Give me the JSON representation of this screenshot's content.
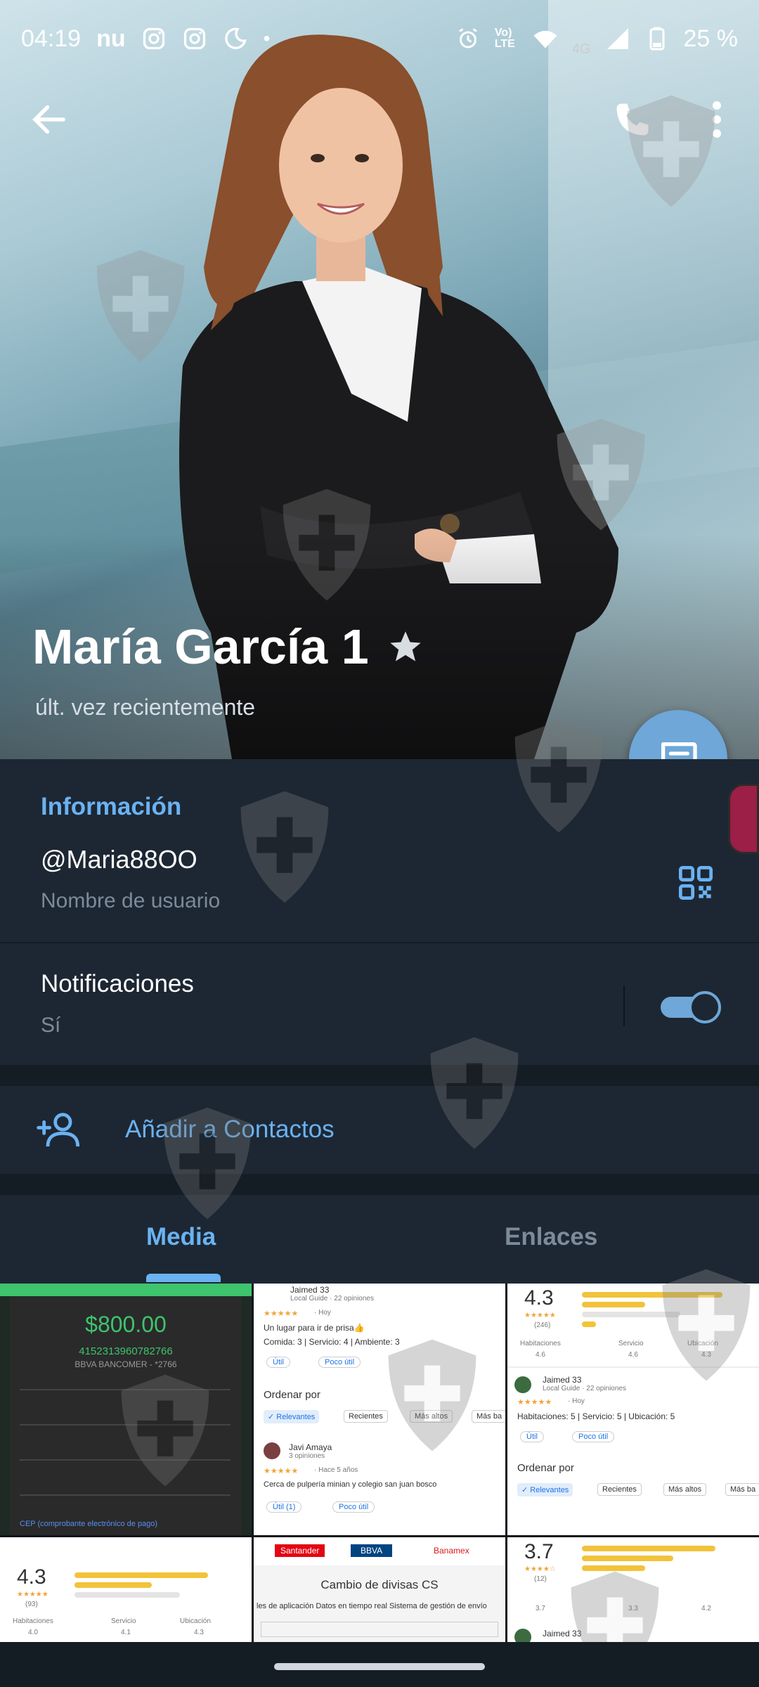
{
  "status_bar": {
    "time": "04:19",
    "carrier_text": "nu",
    "network_volte": "Vo) LTE",
    "network_gen": "4G",
    "battery": "25 %"
  },
  "profile": {
    "name": "María García 1",
    "last_seen": "últ. vez recientemente"
  },
  "info": {
    "section_title": "Información",
    "username": "@Maria88OO",
    "username_caption": "Nombre de usuario",
    "notifications_label": "Notificaciones",
    "notifications_value": "Sí",
    "notifications_on": true
  },
  "actions": {
    "add_contact": "Añadir a Contactos"
  },
  "tabs": [
    {
      "label": "Media",
      "active": true
    },
    {
      "label": "Enlaces",
      "active": false
    }
  ],
  "media": {
    "transfer": {
      "amount": "$800.00",
      "account": "4152313960782766",
      "bank": "BBVA BANCOMER - *2766",
      "link": "CEP (comprobante electrónico de pago)"
    },
    "review1": {
      "author": "Jaimed 33",
      "meta": "Local Guide · 22 opiniones",
      "when": "· Hoy",
      "text": "Un lugar para ir de prisa👍",
      "scores": "Comida: 3 | Servicio: 4 | Ambiente: 3",
      "btn_useful": "Útil",
      "btn_not_useful": "Poco útil",
      "order_by": "Ordenar por",
      "chips": [
        "✓ Relevantes",
        "Recientes",
        "Más altos",
        "Más ba"
      ],
      "author2": "Javi Amaya",
      "meta2": "3 opiniones",
      "when2": "· Hace 5 años",
      "text2": "Cerca de pulpería minian y colegio san juan bosco",
      "btn_useful2": "Útil (1)",
      "btn_not_useful2": "Poco útil"
    },
    "review2": {
      "rating": "4.3",
      "count": "(246)",
      "sub_labels": [
        "Habitaciones",
        "Servicio",
        "Ubicación"
      ],
      "sub_values": [
        "4.6",
        "4.6",
        "4.3"
      ],
      "author": "Jaimed 33",
      "meta": "Local Guide · 22 opiniones",
      "when": "· Hoy",
      "scores": "Habitaciones: 5 | Servicio: 5 | Ubicación: 5",
      "btn_useful": "Útil",
      "btn_not_useful": "Poco útil",
      "order_by": "Ordenar por",
      "chips": [
        "✓ Relevantes",
        "Recientes",
        "Más altos",
        "Más ba"
      ]
    },
    "review3": {
      "rating": "4.3",
      "count": "(93)",
      "sub_labels": [
        "Habitaciones",
        "Servicio",
        "Ubicación"
      ],
      "sub_values": [
        "4.0",
        "4.1",
        "4.3"
      ]
    },
    "exchange": {
      "brand1": "Santander",
      "brand2": "BBVA",
      "brand3": "Banamex",
      "title": "Cambio de divisas CS",
      "text": "les de aplicación Datos en tiempo real Sistema de gestión de envío"
    },
    "review4": {
      "rating": "3.7",
      "count": "(12)",
      "sub_values": [
        "3.7",
        "3.3",
        "4.2"
      ],
      "author": "Jaimed 33"
    }
  },
  "colors": {
    "background": "#1d2733",
    "accent": "#6ab2f2",
    "fab": "#6ea7d8",
    "secondary_text": "#7d8b99"
  }
}
